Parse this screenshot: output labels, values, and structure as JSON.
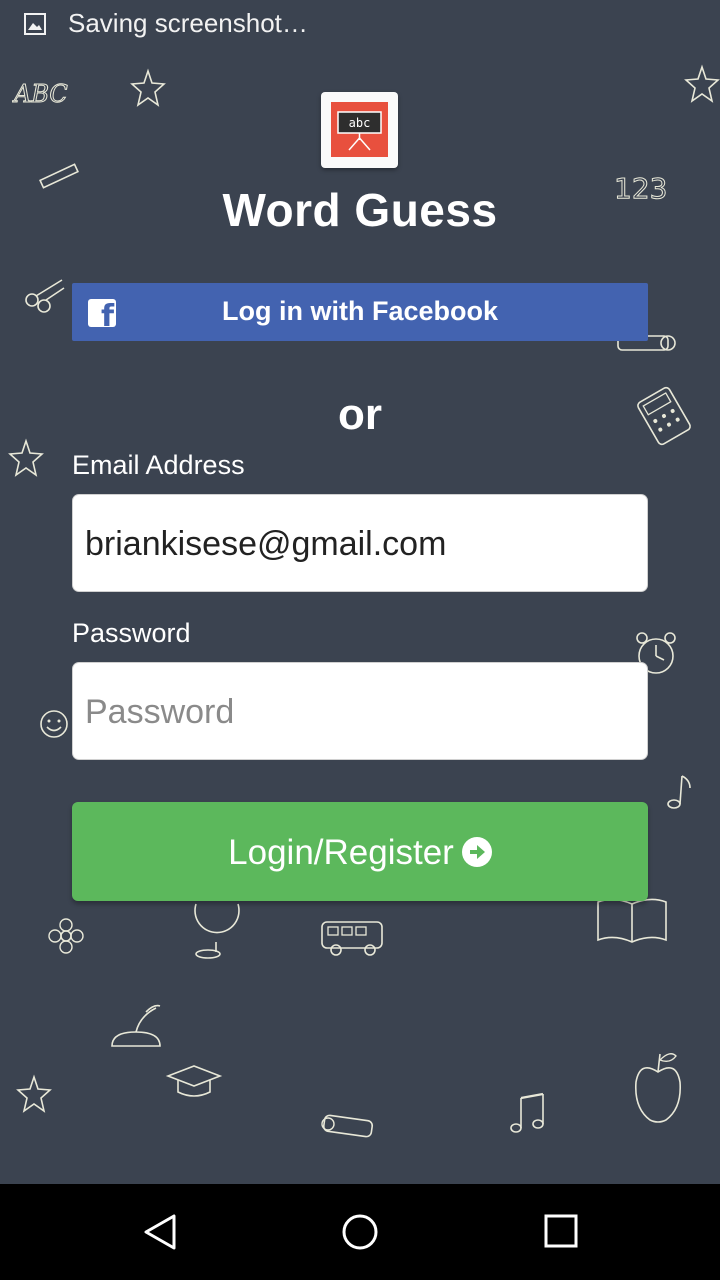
{
  "status_bar": {
    "text": "Saving screenshot…",
    "icon": "image-icon"
  },
  "app": {
    "title": "Word Guess",
    "logo_text": "abc",
    "logo_color": "#e8503e"
  },
  "facebook": {
    "label": "Log in with Facebook",
    "color": "#4363b0",
    "icon": "facebook-icon"
  },
  "divider_text": "or",
  "form": {
    "email_label": "Email Address",
    "email_value": "briankisese@gmail.com",
    "password_label": "Password",
    "password_placeholder": "Password",
    "password_value": ""
  },
  "login_button": {
    "label": "Login/Register",
    "color": "#5cb85c",
    "icon": "arrow-circle-right-icon"
  },
  "background": {
    "color": "#3b4350",
    "doodle_text": {
      "abc": "ABC",
      "numbers": "123"
    }
  },
  "nav_bar": {
    "back_icon": "back-triangle-icon",
    "home_icon": "home-circle-icon",
    "recents_icon": "recents-square-icon"
  }
}
